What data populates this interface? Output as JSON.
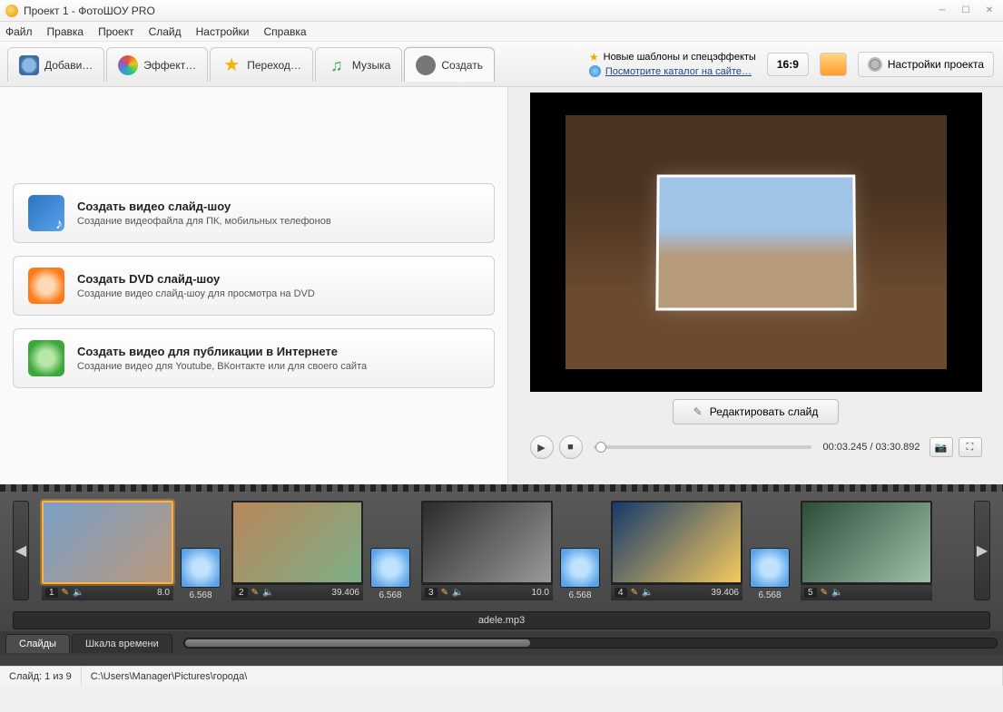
{
  "title": "Проект 1 - ФотоШОУ PRO",
  "menu": {
    "file": "Файл",
    "edit": "Правка",
    "project": "Проект",
    "slide": "Слайд",
    "settings": "Настройки",
    "help": "Справка"
  },
  "tabs": {
    "add": "Добави…",
    "effects": "Эффект…",
    "transitions": "Переход…",
    "music": "Музыка",
    "create": "Создать"
  },
  "news": {
    "line1": "Новые шаблоны и спецэффекты",
    "line2": "Посмотрите каталог на сайте…"
  },
  "aspect": "16:9",
  "projectSettings": "Настройки проекта",
  "cards": {
    "video": {
      "title": "Создать видео слайд-шоу",
      "desc": "Создание видеофайла для ПК, мобильных телефонов"
    },
    "dvd": {
      "title": "Создать DVD слайд-шоу",
      "desc": "Создание видео слайд-шоу для просмотра на DVD"
    },
    "web": {
      "title": "Создать видео для публикации в Интернете",
      "desc": "Создание видео для Youtube, ВКонтакте или для своего сайта"
    }
  },
  "editSlide": "Редактировать слайд",
  "playback": {
    "cur": "00:03.245",
    "sep": " / ",
    "total": "03:30.892"
  },
  "slides": [
    {
      "num": "1",
      "dur": "8.0",
      "trans": "6.568"
    },
    {
      "num": "2",
      "dur": "39.406",
      "trans": "6.568"
    },
    {
      "num": "3",
      "dur": "10.0",
      "trans": "6.568"
    },
    {
      "num": "4",
      "dur": "39.406",
      "trans": "6.568"
    },
    {
      "num": "5",
      "dur": ""
    }
  ],
  "audioTrack": "adele.mp3",
  "bottomTabs": {
    "slides": "Слайды",
    "timeline": "Шкала времени"
  },
  "status": {
    "slide": "Слайд: 1 из 9",
    "path": "C:\\Users\\Manager\\Pictures\\города\\"
  }
}
